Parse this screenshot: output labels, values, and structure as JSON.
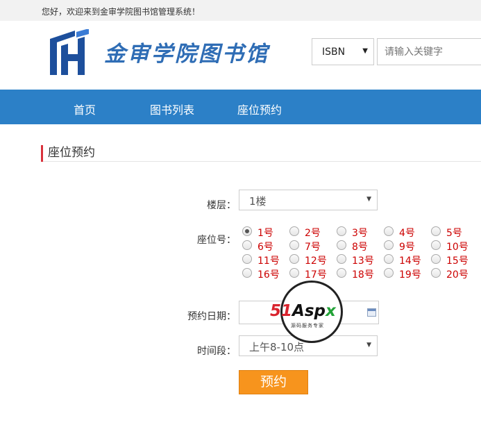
{
  "topbar": {
    "welcome": "您好，欢迎来到金审学院图书馆管理系统！"
  },
  "header": {
    "logo_text": "金审学院图书馆",
    "search": {
      "type_value": "ISBN",
      "placeholder": "请输入关键字"
    }
  },
  "nav": {
    "items": [
      {
        "label": "首页"
      },
      {
        "label": "图书列表"
      },
      {
        "label": "座位预约"
      }
    ]
  },
  "page": {
    "title": "座位预约"
  },
  "form": {
    "floor": {
      "label": "楼层：",
      "value": "1楼"
    },
    "seat": {
      "label": "座位号：",
      "selected": "1号",
      "options": [
        "1号",
        "2号",
        "3号",
        "4号",
        "5号",
        "6号",
        "7号",
        "8号",
        "9号",
        "10号",
        "11号",
        "12号",
        "13号",
        "14号",
        "15号",
        "16号",
        "17号",
        "18号",
        "19号",
        "20号"
      ]
    },
    "date": {
      "label": "预约日期：",
      "value": ""
    },
    "period": {
      "label": "时间段：",
      "value": "上午8-10点"
    },
    "submit_label": "预约"
  },
  "watermark": {
    "brand_51": "51",
    "brand_asp": "Asp",
    "brand_x": "x",
    "tagline": "源码服务专家"
  },
  "colors": {
    "nav_bg": "#2c80c7",
    "accent": "#d9313b",
    "submit_bg": "#f7941d",
    "seat_text": "#cc0000",
    "logo": "#2f6db5"
  },
  "icons": {
    "calendar": "calendar-icon",
    "caret": "chevron-down-icon",
    "logo": "library-logo-icon"
  }
}
